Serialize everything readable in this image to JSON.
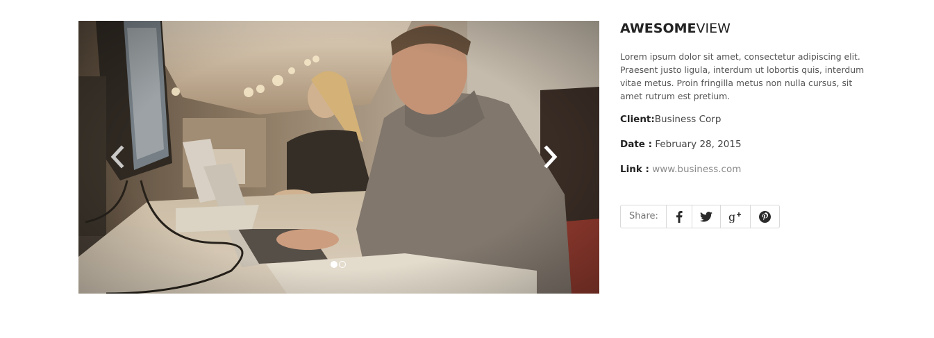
{
  "project": {
    "title_bold": "AWESOME",
    "title_light": "VIEW",
    "description": "Lorem ipsum dolor sit amet, consectetur adipiscing elit. Praesent justo ligula, interdum ut lobortis quis, interdum vitae metus. Proin fringilla metus non nulla cursus, sit amet rutrum est pretium.",
    "client_label": "Client:",
    "client_value": "Business Corp",
    "date_label": "Date :",
    "date_value": "February 28, 2015",
    "link_label": "Link :",
    "link_value": "www.business.com"
  },
  "slider": {
    "image": "photo-office-man-laptop",
    "prev_icon": "chevron-left-icon",
    "next_icon": "chevron-right-icon",
    "slide_count": 2,
    "active_slide": 1
  },
  "share": {
    "label": "Share:",
    "buttons": [
      "facebook-icon",
      "twitter-icon",
      "google-plus-icon",
      "pinterest-icon"
    ]
  },
  "colors": {
    "title": "#222222",
    "body_text": "#555555",
    "link": "#8a8a8a",
    "border": "#d9d9d9"
  }
}
